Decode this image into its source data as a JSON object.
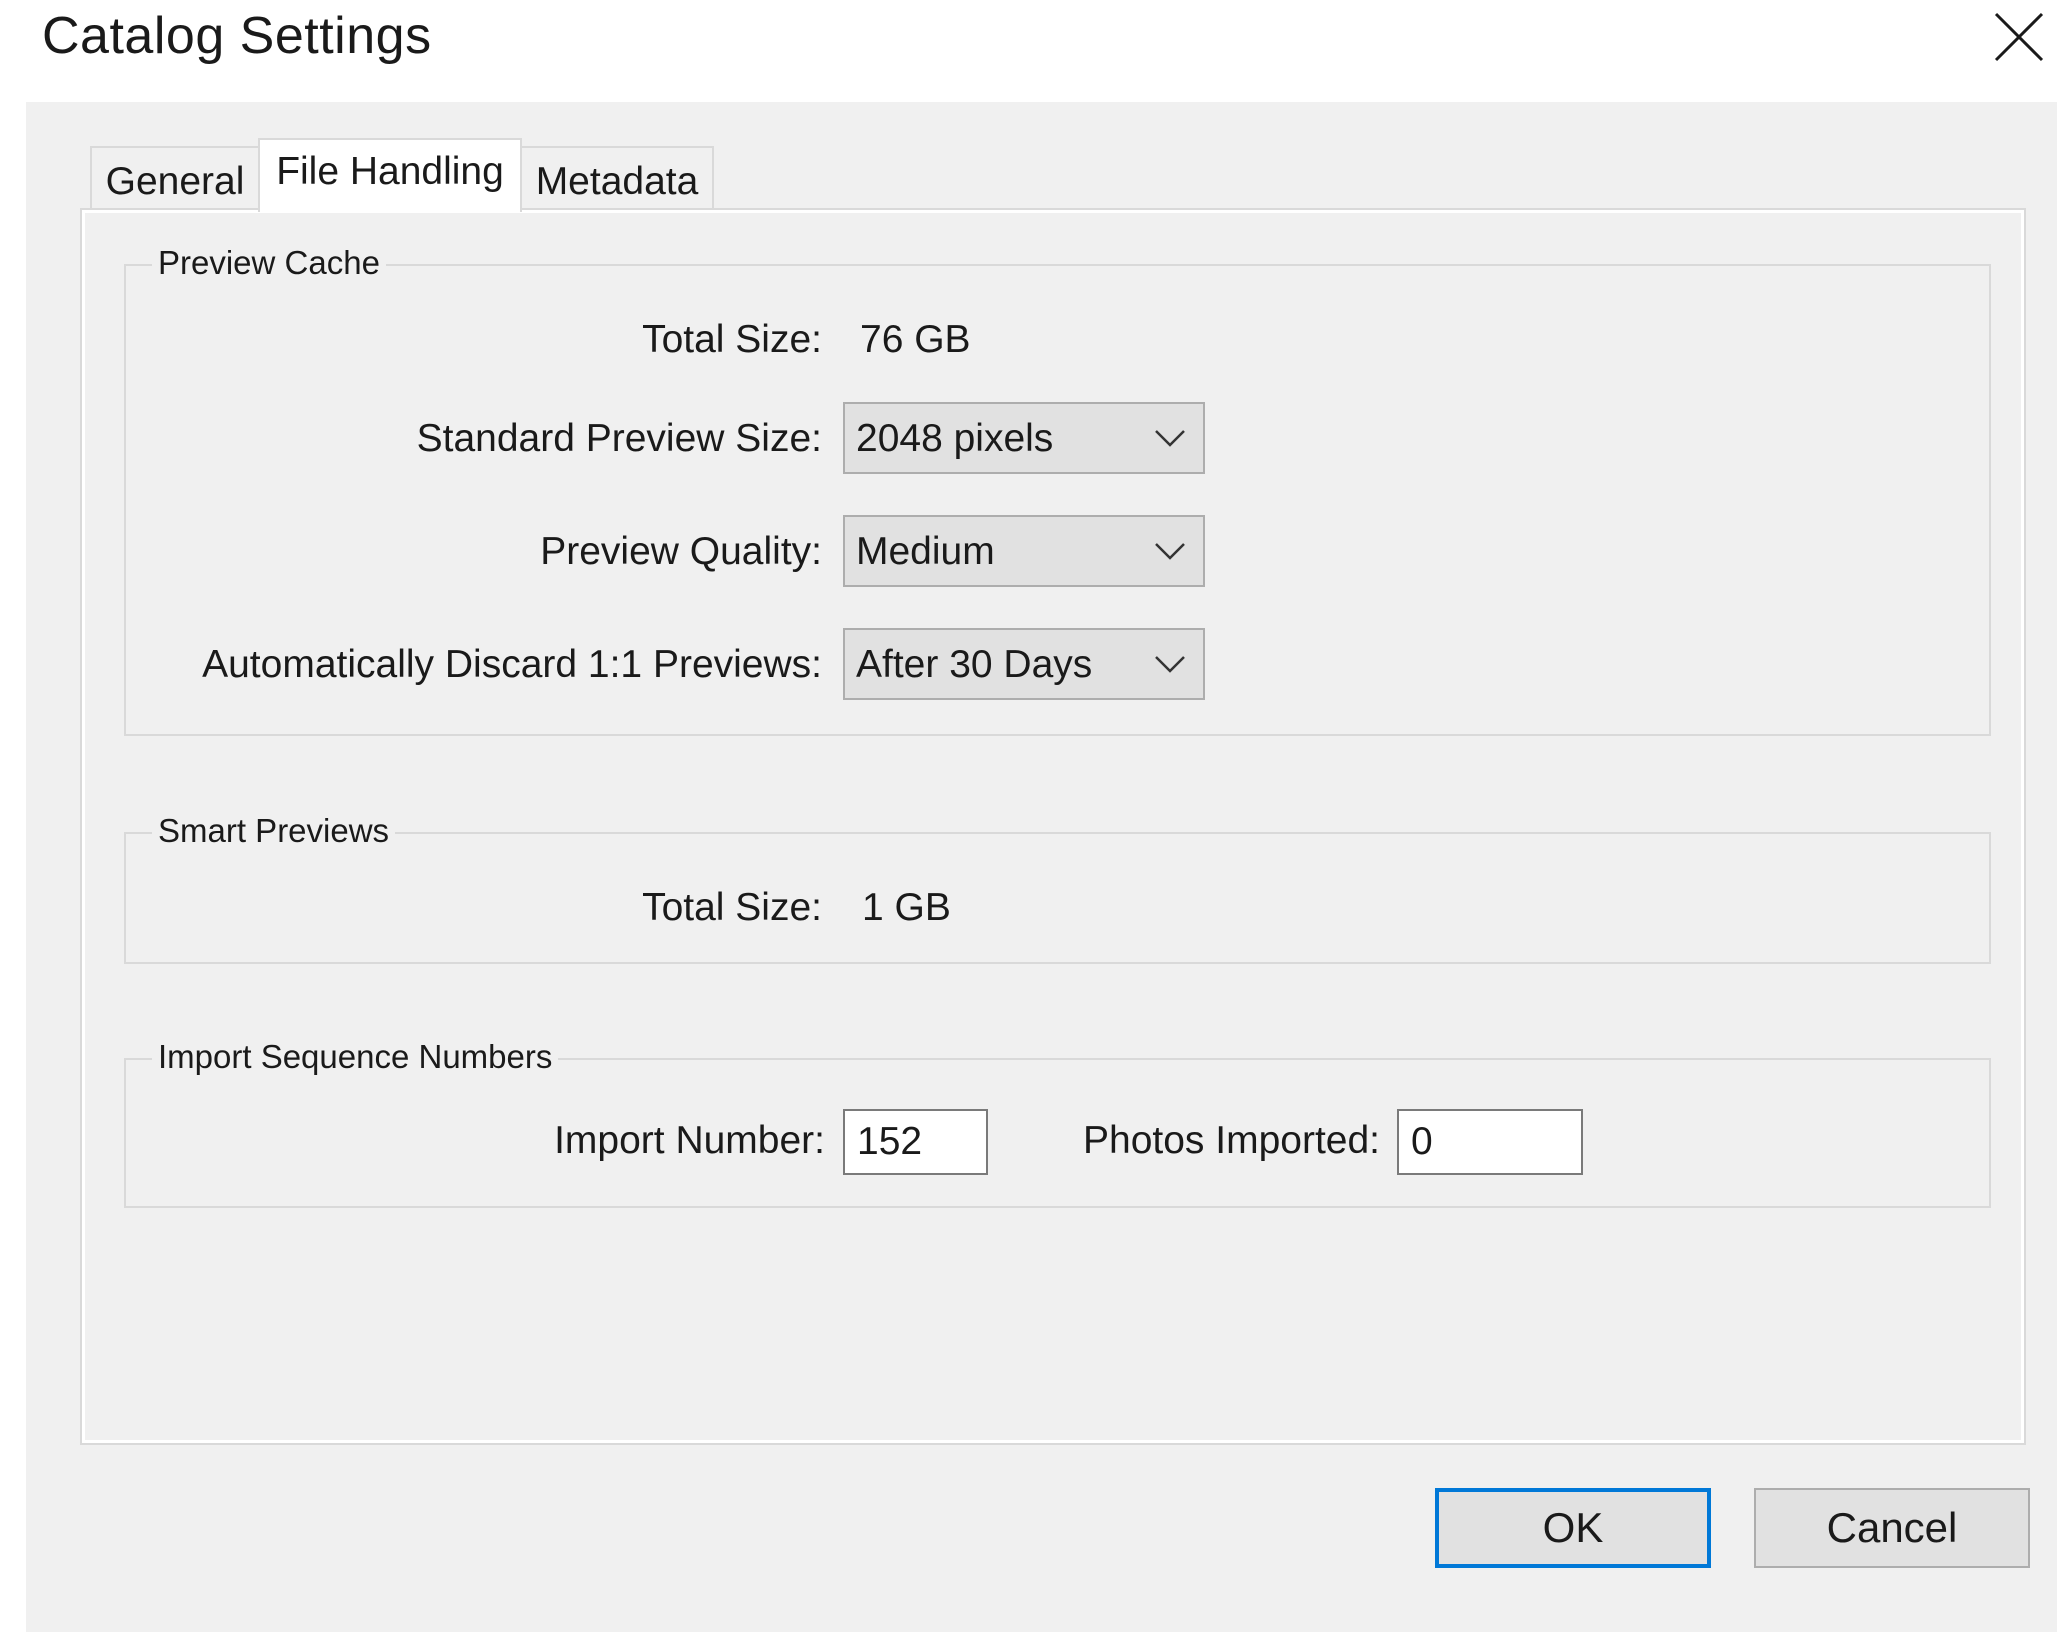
{
  "window": {
    "title": "Catalog Settings"
  },
  "tabs": [
    {
      "label": "General",
      "active": false
    },
    {
      "label": "File Handling",
      "active": true
    },
    {
      "label": "Metadata",
      "active": false
    }
  ],
  "preview_cache": {
    "legend": "Preview Cache",
    "total_size_label": "Total Size:",
    "total_size_value": "76 GB",
    "standard_preview_size_label": "Standard Preview Size:",
    "standard_preview_size_value": "2048 pixels",
    "preview_quality_label": "Preview Quality:",
    "preview_quality_value": "Medium",
    "discard_label": "Automatically Discard 1:1 Previews:",
    "discard_value": "After 30 Days"
  },
  "smart_previews": {
    "legend": "Smart Previews",
    "total_size_label": "Total Size:",
    "total_size_value": "1 GB"
  },
  "import_sequence": {
    "legend": "Import Sequence Numbers",
    "import_number_label": "Import Number:",
    "import_number_value": "152",
    "photos_imported_label": "Photos Imported:",
    "photos_imported_value": "0"
  },
  "buttons": {
    "ok_label": "OK",
    "cancel_label": "Cancel"
  },
  "icons": {
    "close": "close-icon",
    "chevron": "chevron-down-icon"
  },
  "colors": {
    "dialog_background": "#f0f0f0",
    "default_button_border": "#0078d7"
  }
}
